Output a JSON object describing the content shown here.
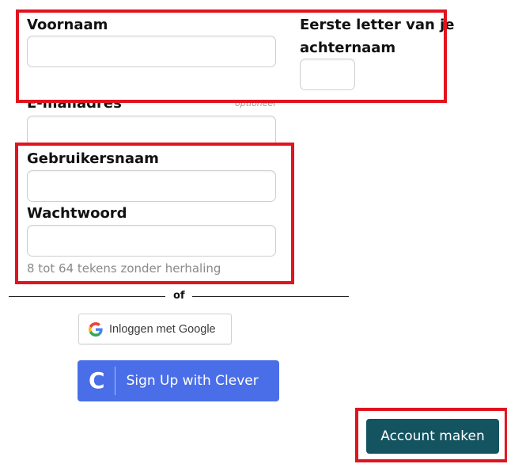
{
  "form": {
    "first_name_label": "Voornaam",
    "last_initial_label_line1": "Eerste letter van je",
    "last_initial_label_line2": "achternaam",
    "email_label": "E-mailadres",
    "email_optional": "optioneel",
    "username_label": "Gebruikersnaam",
    "password_label": "Wachtwoord",
    "password_hint": "8 tot 64 tekens zonder herhaling"
  },
  "divider": {
    "text": "of"
  },
  "sso": {
    "google_label": "Inloggen met Google",
    "clever_label": "Sign Up with Clever",
    "clever_logo_letter": "C"
  },
  "submit": {
    "label": "Account maken"
  },
  "colors": {
    "highlight": "#e0141f",
    "clever_blue": "#4a6ee8",
    "submit_teal": "#145360"
  },
  "icons": {
    "google": "google-g-icon",
    "clever": "clever-c-icon"
  }
}
